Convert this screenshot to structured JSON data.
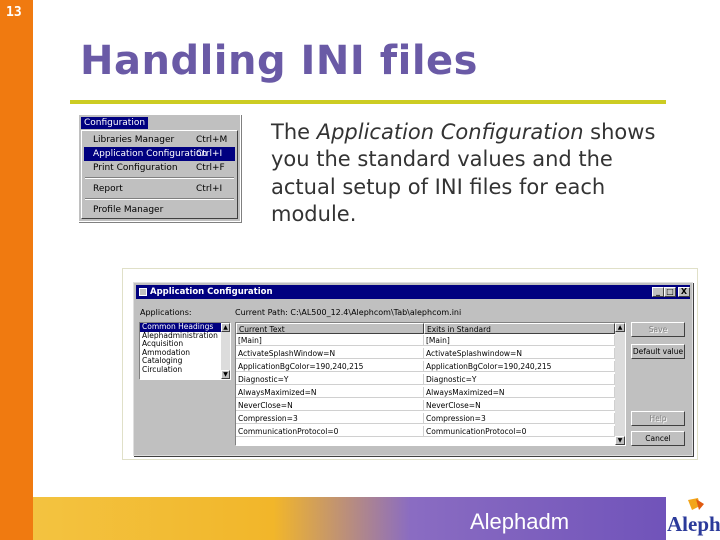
{
  "slide": {
    "number": "13",
    "title": "Handling INI files",
    "footer": "Alephadm",
    "logo_text": "Aleph"
  },
  "body": {
    "pre": "The ",
    "italic": "Application Configuration",
    "post": " shows you the standard values and the actual setup of INI files for each module."
  },
  "menu": {
    "title": "Configuration",
    "items": [
      {
        "label": "Libraries Manager",
        "shortcut": "Ctrl+M",
        "selected": false
      },
      {
        "label": "Application Configuration",
        "shortcut": "Ctrl+I",
        "selected": true
      },
      {
        "label": "Print Configuration",
        "shortcut": "Ctrl+F",
        "selected": false
      },
      {
        "label": "Report",
        "shortcut": "Ctrl+I",
        "selected": false
      },
      {
        "label": "Profile Manager",
        "shortcut": "",
        "selected": false
      }
    ]
  },
  "dialog": {
    "title": "Application Configuration",
    "applications_label": "Applications:",
    "current_path": "Current Path: C:\\AL500_12.4\\Alephcom\\Tab\\alephcom.ini",
    "applications": [
      "Common Headings",
      "Alephadministration",
      "Acquisition",
      "Ammodation",
      "Cataloging",
      "Circulation"
    ],
    "columns": [
      "Current Text",
      "Exits in Standard"
    ],
    "rows": [
      [
        "[Main]",
        "[Main]"
      ],
      [
        "ActivateSplashWindow=N",
        "ActivateSplashwindow=N"
      ],
      [
        "ApplicationBgColor=190,240,215",
        "ApplicationBgColor=190,240,215"
      ],
      [
        "Diagnostic=Y",
        "Diagnostic=Y"
      ],
      [
        "AlwaysMaximized=N",
        "AlwaysMaximized=N"
      ],
      [
        "NeverClose=N",
        "NeverClose=N"
      ],
      [
        "Compression=3",
        "Compression=3"
      ],
      [
        "CommunicationProtocol=0",
        "CommunicationProtocol=0"
      ]
    ],
    "buttons": {
      "save": "Save",
      "default_value": "Default value",
      "help": "Help",
      "cancel": "Cancel"
    },
    "window_buttons": [
      "_",
      "□",
      "X"
    ]
  },
  "colors": {
    "orange": "#f07a10",
    "title": "#6a5aa6",
    "rule": "#cccc22",
    "win_title": "#000080"
  }
}
